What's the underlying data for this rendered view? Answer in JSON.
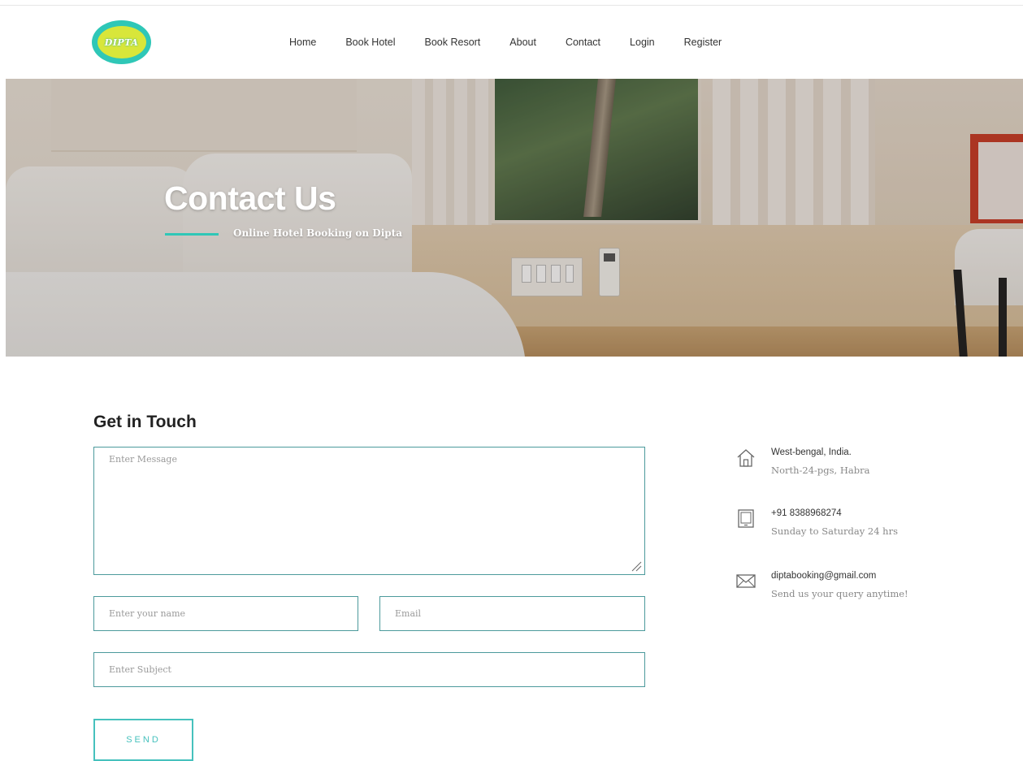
{
  "header": {
    "logo_text": "DIPTA",
    "nav": [
      {
        "label": "Home"
      },
      {
        "label": "Book Hotel"
      },
      {
        "label": "Book Resort"
      },
      {
        "label": "About"
      },
      {
        "label": "Contact"
      },
      {
        "label": "Login"
      },
      {
        "label": "Register"
      }
    ]
  },
  "hero": {
    "title": "Contact Us",
    "subtitle": "Online Hotel Booking on Dipta"
  },
  "contact": {
    "heading": "Get in Touch",
    "message_placeholder": "Enter Message",
    "name_placeholder": "Enter your name",
    "email_placeholder": "Email",
    "subject_placeholder": "Enter Subject",
    "send_label": "SEND"
  },
  "info": [
    {
      "icon": "home-icon",
      "line1": "West-bengal, India.",
      "line2": "North-24-pgs, Habra"
    },
    {
      "icon": "tablet-icon",
      "line1": "+91 8388968274",
      "line2": "Sunday to Saturday 24 hrs"
    },
    {
      "icon": "envelope-icon",
      "line1": "diptabooking@gmail.com",
      "line2": "Send us your query anytime!"
    }
  ],
  "colors": {
    "accent": "#2fc7b7",
    "field_border": "#4c9a9c",
    "button": "#46c1bd"
  }
}
